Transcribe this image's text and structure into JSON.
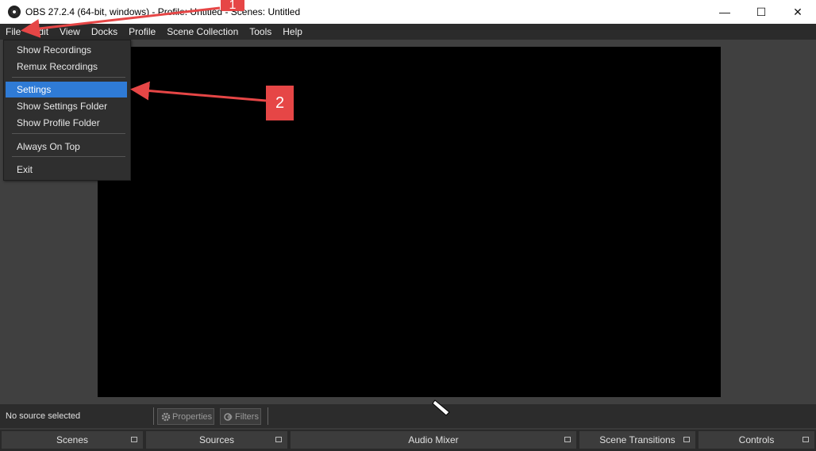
{
  "window": {
    "title": "OBS 27.2.4 (64-bit, windows) - Profile: Untitled - Scenes: Untitled",
    "minimize_glyph": "—",
    "maximize_glyph": "☐",
    "close_glyph": "✕"
  },
  "menubar": {
    "items": [
      "File",
      "Edit",
      "View",
      "Docks",
      "Profile",
      "Scene Collection",
      "Tools",
      "Help"
    ]
  },
  "file_menu": {
    "items": [
      {
        "label": "Show Recordings"
      },
      {
        "label": "Remux Recordings"
      },
      {
        "label": "Settings",
        "selected": true
      },
      {
        "label": "Show Settings Folder"
      },
      {
        "label": "Show Profile Folder"
      },
      {
        "label": "Always On Top"
      },
      {
        "label": "Exit"
      }
    ]
  },
  "source_bar": {
    "status": "No source selected",
    "properties_label": "Properties",
    "filters_label": "Filters"
  },
  "docks": {
    "scenes": "Scenes",
    "sources": "Sources",
    "audio_mixer": "Audio Mixer",
    "scene_transitions": "Scene Transitions",
    "controls": "Controls"
  },
  "annotations": {
    "badge1": "1",
    "badge2": "2",
    "color": "#e64646"
  },
  "colors": {
    "accent_selected": "#2f7bd6",
    "preview_bg": "#000000"
  }
}
